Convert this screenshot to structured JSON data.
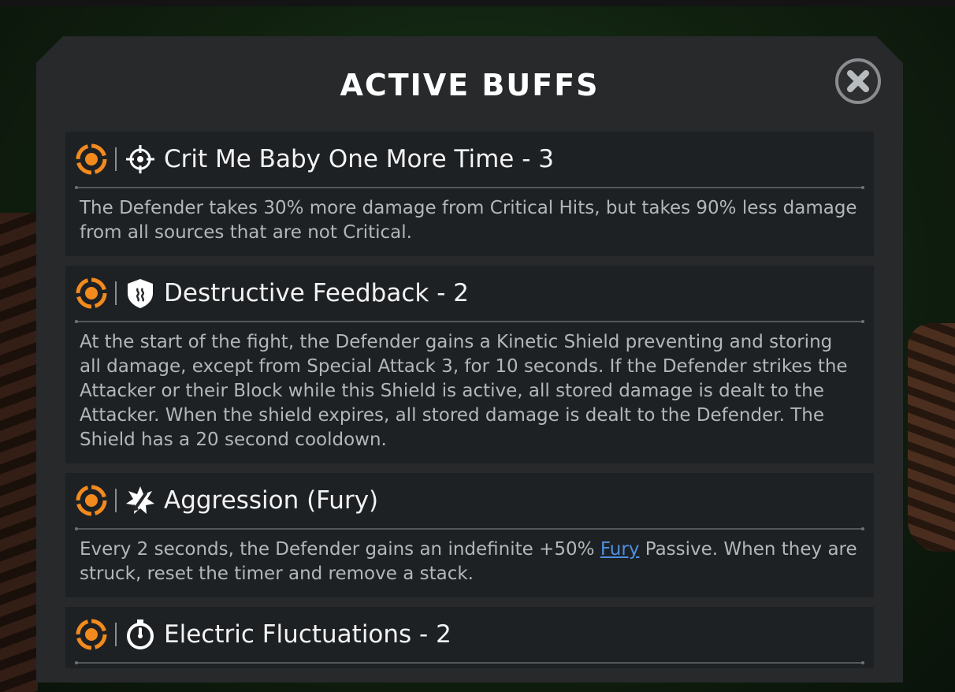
{
  "dialog": {
    "title": "ACTIVE BUFFS"
  },
  "colors": {
    "accent_orange": "#f28a1e",
    "link_blue": "#4d8fe0",
    "panel_bg": "#27292b",
    "row_bg": "#1e2124"
  },
  "buffs": [
    {
      "status_icon": "orange-target-icon",
      "type_icon": "crosshair-icon",
      "name": "Crit Me Baby One More Time - 3",
      "description": "The Defender takes 30% more damage from Critical Hits, but takes 90% less damage from all sources that are not Critical."
    },
    {
      "status_icon": "orange-target-icon",
      "type_icon": "shield-icon",
      "name": "Destructive Feedback - 2",
      "description": "At the start of the fight, the Defender gains a Kinetic Shield preventing and storing all damage, except from Special Attack 3, for 10 seconds. If the Defender strikes the Attacker or their Block while this Shield is active, all stored damage is dealt to the Attacker. When the shield expires, all stored damage is dealt to the Defender. The Shield has a 20 second cooldown."
    },
    {
      "status_icon": "orange-target-icon",
      "type_icon": "fury-sword-icon",
      "name": "Aggression (Fury)",
      "description_before": "Every 2 seconds, the Defender gains an indefinite +50% ",
      "description_link": "Fury",
      "description_after": " Passive. When they are struck, reset the timer and remove a stack."
    },
    {
      "status_icon": "orange-target-icon",
      "type_icon": "stopwatch-icon",
      "name": "Electric Fluctuations - 2"
    }
  ]
}
